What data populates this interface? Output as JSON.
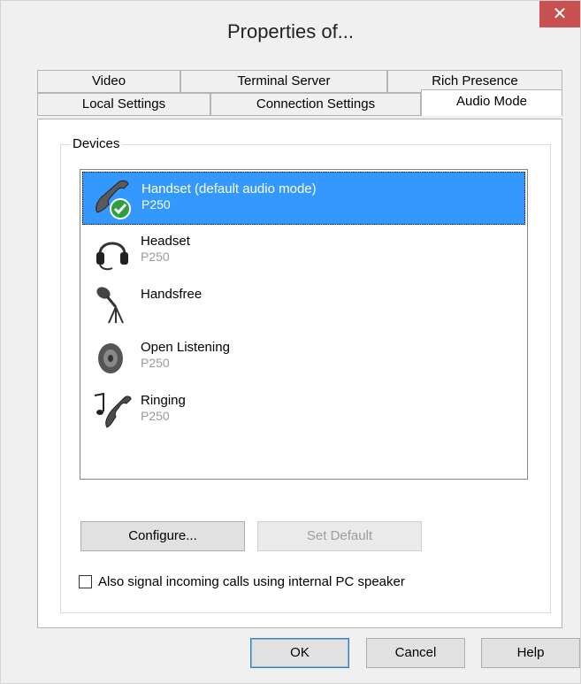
{
  "window": {
    "title": "Properties of...",
    "close_glyph": "✕"
  },
  "tabs_row1": [
    {
      "label": "Video"
    },
    {
      "label": "Terminal Server"
    },
    {
      "label": "Rich Presence"
    }
  ],
  "tabs_row2": [
    {
      "label": "Local Settings"
    },
    {
      "label": "Connection Settings"
    },
    {
      "label": "Audio Mode",
      "active": true
    }
  ],
  "devices": {
    "group_label": "Devices",
    "items": [
      {
        "name": "Handset (default audio mode)",
        "sub": "P250",
        "icon": "handset-default-icon",
        "selected": true
      },
      {
        "name": "Headset",
        "sub": "P250",
        "icon": "headset-icon"
      },
      {
        "name": "Handsfree",
        "sub": "",
        "icon": "microphone-icon"
      },
      {
        "name": "Open Listening",
        "sub": "P250",
        "icon": "speaker-icon"
      },
      {
        "name": "Ringing",
        "sub": "P250",
        "icon": "ringing-phone-icon"
      }
    ]
  },
  "buttons": {
    "configure": "Configure...",
    "set_default": "Set Default",
    "ok": "OK",
    "cancel": "Cancel",
    "help": "Help"
  },
  "options": {
    "pc_speaker_label": "Also signal incoming calls using internal PC speaker",
    "pc_speaker_checked": false
  },
  "colors": {
    "selection": "#3399ff",
    "close_button": "#c75050"
  }
}
